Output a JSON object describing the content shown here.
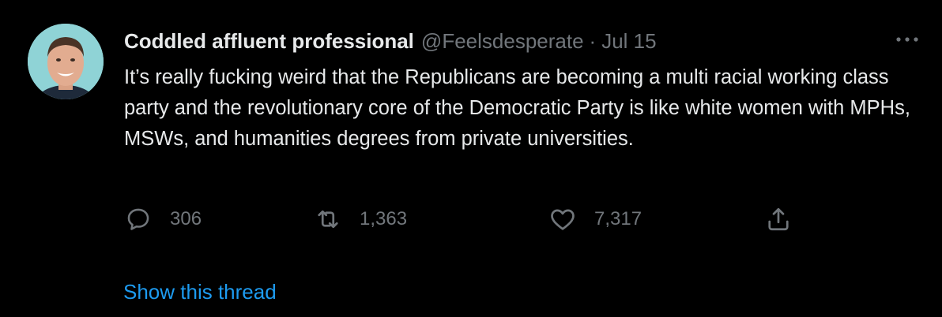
{
  "tweet": {
    "author": {
      "display_name": "Coddled affluent professional",
      "handle": "@Feelsdesperate",
      "avatar_icon": "user-avatar"
    },
    "separator": "·",
    "timestamp": "Jul 15",
    "more_icon": "more-options-icon",
    "text": "It’s really fucking weird that the Republicans are becoming a multi racial working class party and the revolutionary core of the Democratic Party is like white women with MPHs, MSWs, and humanities degrees from private universities."
  },
  "actions": {
    "reply": {
      "icon": "reply-icon",
      "count": "306"
    },
    "retweet": {
      "icon": "retweet-icon",
      "count": "1,363"
    },
    "like": {
      "icon": "like-icon",
      "count": "7,317"
    },
    "share": {
      "icon": "share-icon"
    }
  },
  "show_thread_label": "Show this thread",
  "colors": {
    "background": "#000000",
    "primary_text": "#e7e9ea",
    "secondary_text": "#71767b",
    "link": "#1d9bf0"
  }
}
